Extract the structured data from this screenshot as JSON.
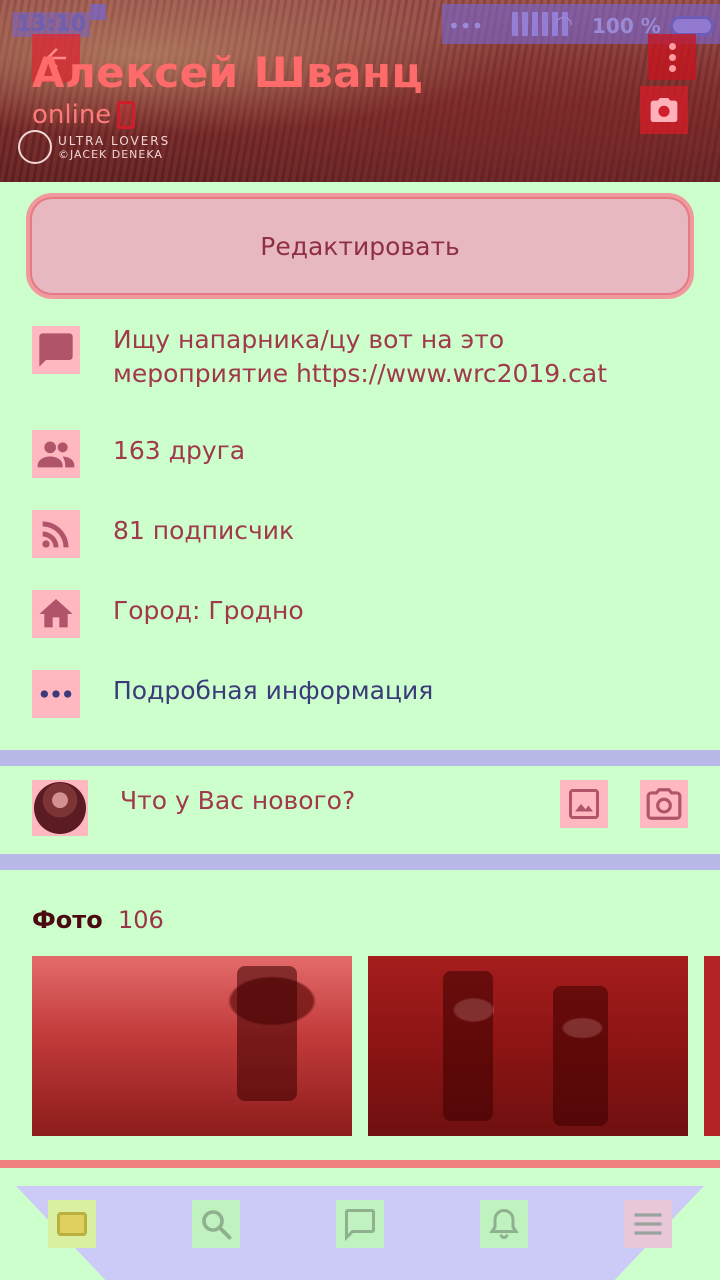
{
  "status_bar": {
    "time": "13:10",
    "battery": "100 %"
  },
  "profile": {
    "name": "Алексей Шванц",
    "online": "online",
    "watermark_line1": "ULTRA LOVERS",
    "watermark_line2": "©JACEK DENEKA"
  },
  "actions": {
    "edit_label": "Редактировать"
  },
  "info": {
    "status": "Ищу напарника/цу вот на это мероприятие https://www.wrc2019.cat",
    "friends": "163 друга",
    "followers": "81 подписчик",
    "city": "Город: Гродно",
    "details": "Подробная информация"
  },
  "composer": {
    "placeholder": "Что у Вас нового?"
  },
  "photos": {
    "title": "Фото",
    "count": "106"
  },
  "icons": {
    "back": "back-arrow-icon",
    "menu": "more-vertical-icon",
    "camera": "camera-icon",
    "status": "comment-icon",
    "friends": "people-icon",
    "followers": "rss-icon",
    "city": "home-icon",
    "details": "more-horizontal-icon",
    "photo": "image-icon",
    "nav": [
      "feed-icon",
      "search-icon",
      "messages-icon",
      "notifications-icon",
      "menu-icon"
    ]
  },
  "colors": {
    "background": "#ccffcc",
    "accent": "#ff6a6a",
    "link": "#3b3a7a",
    "separator": "#b8b8e8"
  }
}
